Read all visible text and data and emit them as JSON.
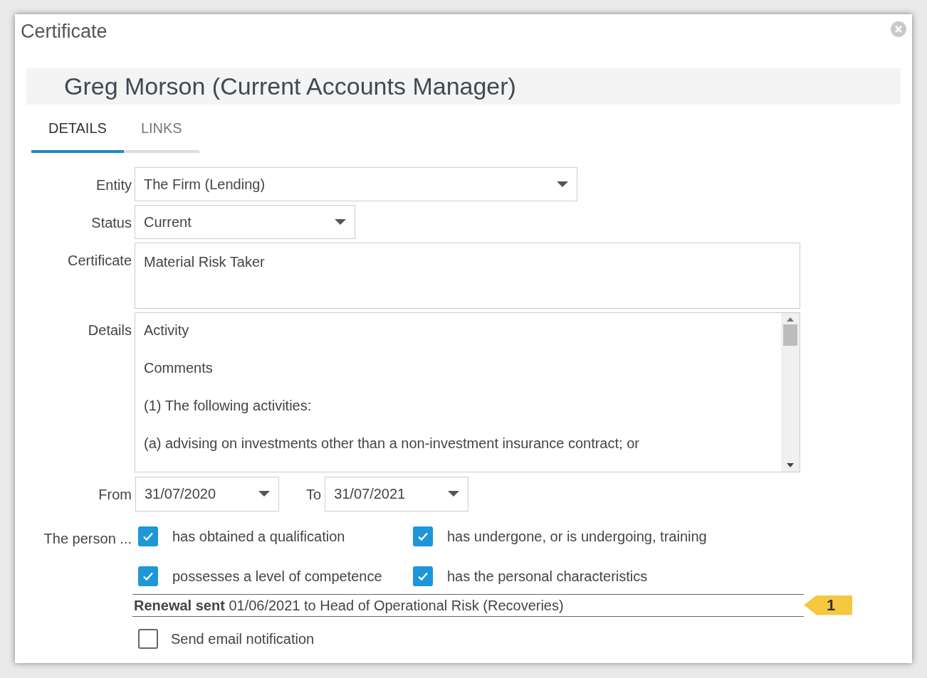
{
  "window": {
    "title": "Certificate"
  },
  "header": {
    "title": "Greg Morson (Current Accounts Manager)"
  },
  "tabs": [
    {
      "label": "DETAILS",
      "selected": true
    },
    {
      "label": "LINKS",
      "selected": false
    }
  ],
  "form": {
    "entity": {
      "label": "Entity",
      "value": "The Firm (Lending)"
    },
    "status": {
      "label": "Status",
      "value": "Current"
    },
    "certificate": {
      "label": "Certificate",
      "value": "Material Risk Taker"
    },
    "details": {
      "label": "Details",
      "lines": [
        "Activity",
        "Comments",
        "(1) The following activities:",
        "(a) advising on investments other than a non-investment insurance contract; or"
      ]
    },
    "from": {
      "label": "From",
      "value": "31/07/2020"
    },
    "to": {
      "label": "To",
      "value": "31/07/2021"
    },
    "person": {
      "label": "The person ...",
      "options": [
        {
          "label": "has obtained a qualification",
          "checked": true
        },
        {
          "label": "has undergone, or is undergoing, training",
          "checked": true
        },
        {
          "label": "possesses a level of competence",
          "checked": true
        },
        {
          "label": "has the personal characteristics",
          "checked": true
        }
      ]
    },
    "renewal": {
      "text": "**Renewal sent** 01/06/2021 to Head of Operational Risk (Recoveries)",
      "badge": "1"
    },
    "notify": {
      "label": "Send email notification",
      "checked": false
    }
  }
}
